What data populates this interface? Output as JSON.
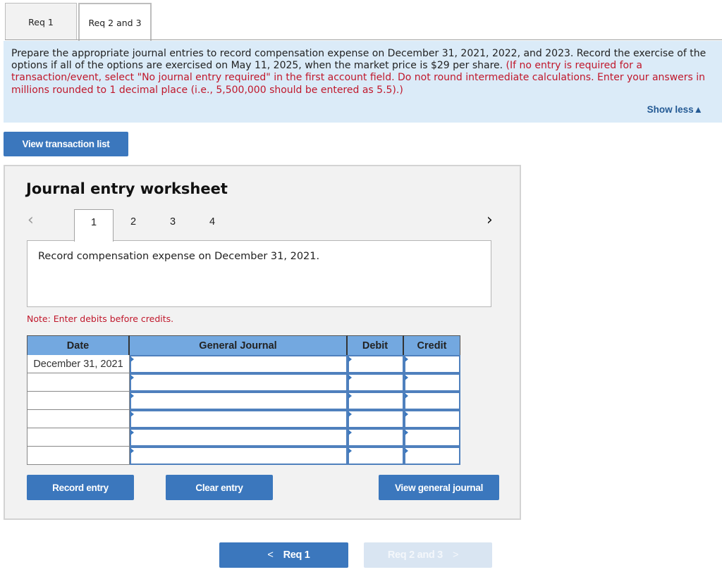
{
  "tabs": [
    {
      "label": "Req 1",
      "active": false
    },
    {
      "label": "Req 2 and 3",
      "active": true
    }
  ],
  "instructions": {
    "text_main": "Prepare the appropriate journal entries to record compensation expense on December 31, 2021, 2022, and 2023. Record the exercise of the options if all of the options are exercised on May 11, 2025, when the market price is $29 per share.",
    "text_red": "(If no entry is required for a transaction/event, select \"No journal entry required\" in the first account field. Do not round intermediate calculations. Enter your answers in millions rounded to 1 decimal place (i.e., 5,500,000 should be entered as 5.5).)",
    "show_less_label": "Show less",
    "show_less_icon": "▲"
  },
  "view_transaction_list_label": "View transaction list",
  "worksheet": {
    "title": "Journal entry worksheet",
    "prev_icon": "‹",
    "next_icon": "›",
    "pages": [
      "1",
      "2",
      "3",
      "4"
    ],
    "active_page": "1",
    "description": "Record compensation expense on December 31, 2021.",
    "note": "Note: Enter debits before credits.",
    "table": {
      "headers": {
        "date": "Date",
        "account": "General Journal",
        "debit": "Debit",
        "credit": "Credit"
      },
      "rows": [
        {
          "date": "December 31, 2021",
          "account": "",
          "debit": "",
          "credit": ""
        },
        {
          "date": "",
          "account": "",
          "debit": "",
          "credit": ""
        },
        {
          "date": "",
          "account": "",
          "debit": "",
          "credit": ""
        },
        {
          "date": "",
          "account": "",
          "debit": "",
          "credit": ""
        },
        {
          "date": "",
          "account": "",
          "debit": "",
          "credit": ""
        },
        {
          "date": "",
          "account": "",
          "debit": "",
          "credit": ""
        }
      ]
    },
    "buttons": {
      "record": "Record entry",
      "clear": "Clear entry",
      "view_general_journal": "View general journal"
    }
  },
  "footer_nav": {
    "prev_label": "Req 1",
    "prev_icon": "<",
    "next_label": "Req 2 and 3",
    "next_icon": ">",
    "next_disabled": true
  }
}
